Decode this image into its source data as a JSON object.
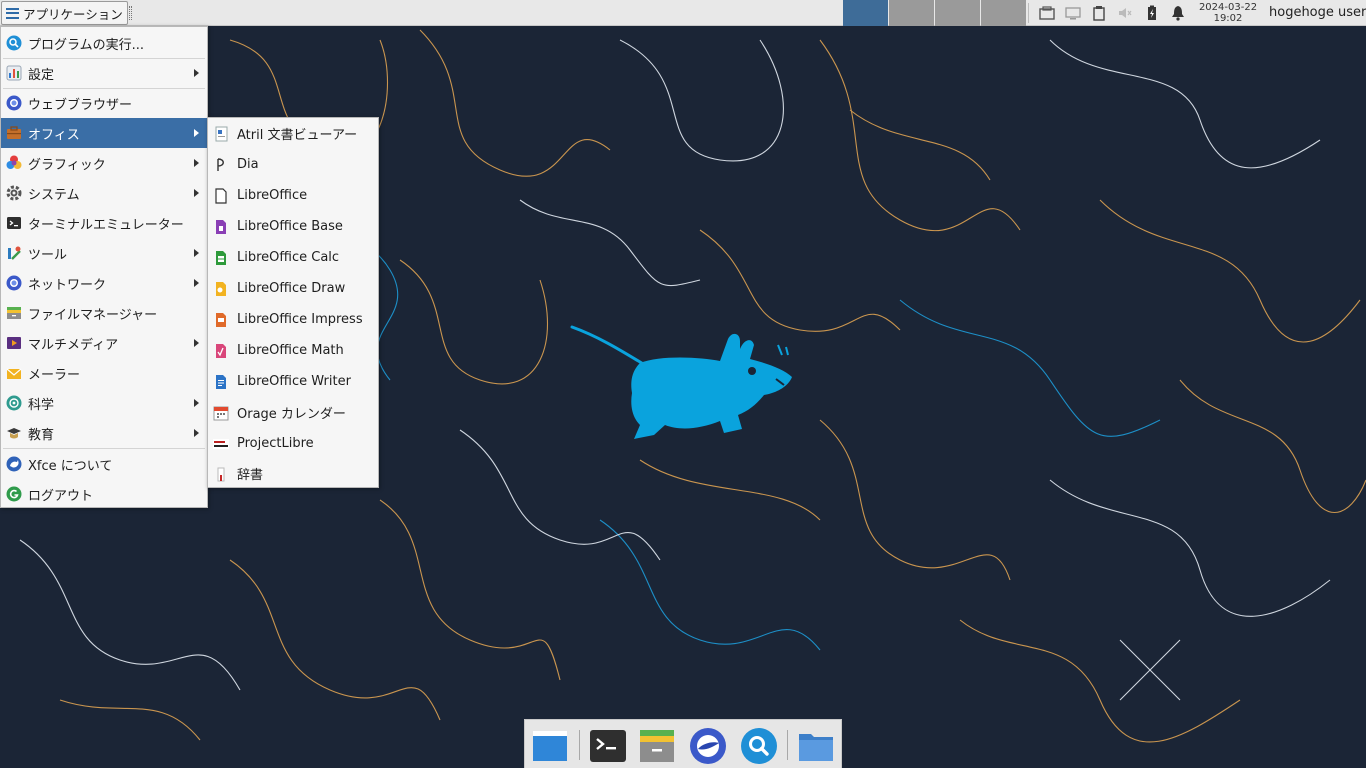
{
  "panel": {
    "apps_button_label": "アプリケーション",
    "clock_date": "2024-03-22",
    "clock_time": "19:02",
    "user": "hogehoge user"
  },
  "main_menu": {
    "items": [
      {
        "label": "プログラムの実行...",
        "icon": "search-icon",
        "submenu": false
      },
      {
        "label": "設定",
        "icon": "settings-icon",
        "submenu": true
      },
      {
        "label": "ウェブブラウザー",
        "icon": "web-browser-icon",
        "submenu": false
      },
      {
        "label": "オフィス",
        "icon": "office-icon",
        "submenu": true,
        "active": true
      },
      {
        "label": "グラフィック",
        "icon": "graphics-icon",
        "submenu": true
      },
      {
        "label": "システム",
        "icon": "system-gear-icon",
        "submenu": true
      },
      {
        "label": "ターミナルエミュレーター",
        "icon": "terminal-icon",
        "submenu": false
      },
      {
        "label": "ツール",
        "icon": "tools-icon",
        "submenu": true
      },
      {
        "label": "ネットワーク",
        "icon": "network-icon",
        "submenu": true
      },
      {
        "label": "ファイルマネージャー",
        "icon": "file-manager-icon",
        "submenu": false
      },
      {
        "label": "マルチメディア",
        "icon": "multimedia-icon",
        "submenu": true
      },
      {
        "label": "メーラー",
        "icon": "mail-icon",
        "submenu": false
      },
      {
        "label": "科学",
        "icon": "science-icon",
        "submenu": true
      },
      {
        "label": "教育",
        "icon": "education-icon",
        "submenu": true
      },
      {
        "label": "Xfce について",
        "icon": "xfce-about-icon",
        "submenu": false
      },
      {
        "label": "ログアウト",
        "icon": "logout-icon",
        "submenu": false
      }
    ]
  },
  "office_menu": {
    "items": [
      {
        "label": "Atril 文書ビューアー",
        "icon": "atril-icon"
      },
      {
        "label": "Dia",
        "icon": "dia-icon"
      },
      {
        "label": "LibreOffice",
        "icon": "libreoffice-icon"
      },
      {
        "label": "LibreOffice Base",
        "icon": "libreoffice-base-icon"
      },
      {
        "label": "LibreOffice Calc",
        "icon": "libreoffice-calc-icon"
      },
      {
        "label": "LibreOffice Draw",
        "icon": "libreoffice-draw-icon"
      },
      {
        "label": "LibreOffice Impress",
        "icon": "libreoffice-impress-icon"
      },
      {
        "label": "LibreOffice Math",
        "icon": "libreoffice-math-icon"
      },
      {
        "label": "LibreOffice Writer",
        "icon": "libreoffice-writer-icon"
      },
      {
        "label": "Orage カレンダー",
        "icon": "calendar-icon"
      },
      {
        "label": "ProjectLibre",
        "icon": "projectlibre-icon"
      },
      {
        "label": "辞書",
        "icon": "dictionary-icon"
      }
    ]
  },
  "dock": {
    "items": [
      "show-desktop-icon",
      "terminal-icon",
      "file-manager-icon",
      "web-browser-icon",
      "app-finder-icon",
      "folder-icon"
    ]
  },
  "colors": {
    "menu_highlight": "#3a6ea6",
    "workspace_active": "#3e6c98",
    "desktop_bg": "#1b2536",
    "mouse_logo": "#0aa3dd"
  }
}
